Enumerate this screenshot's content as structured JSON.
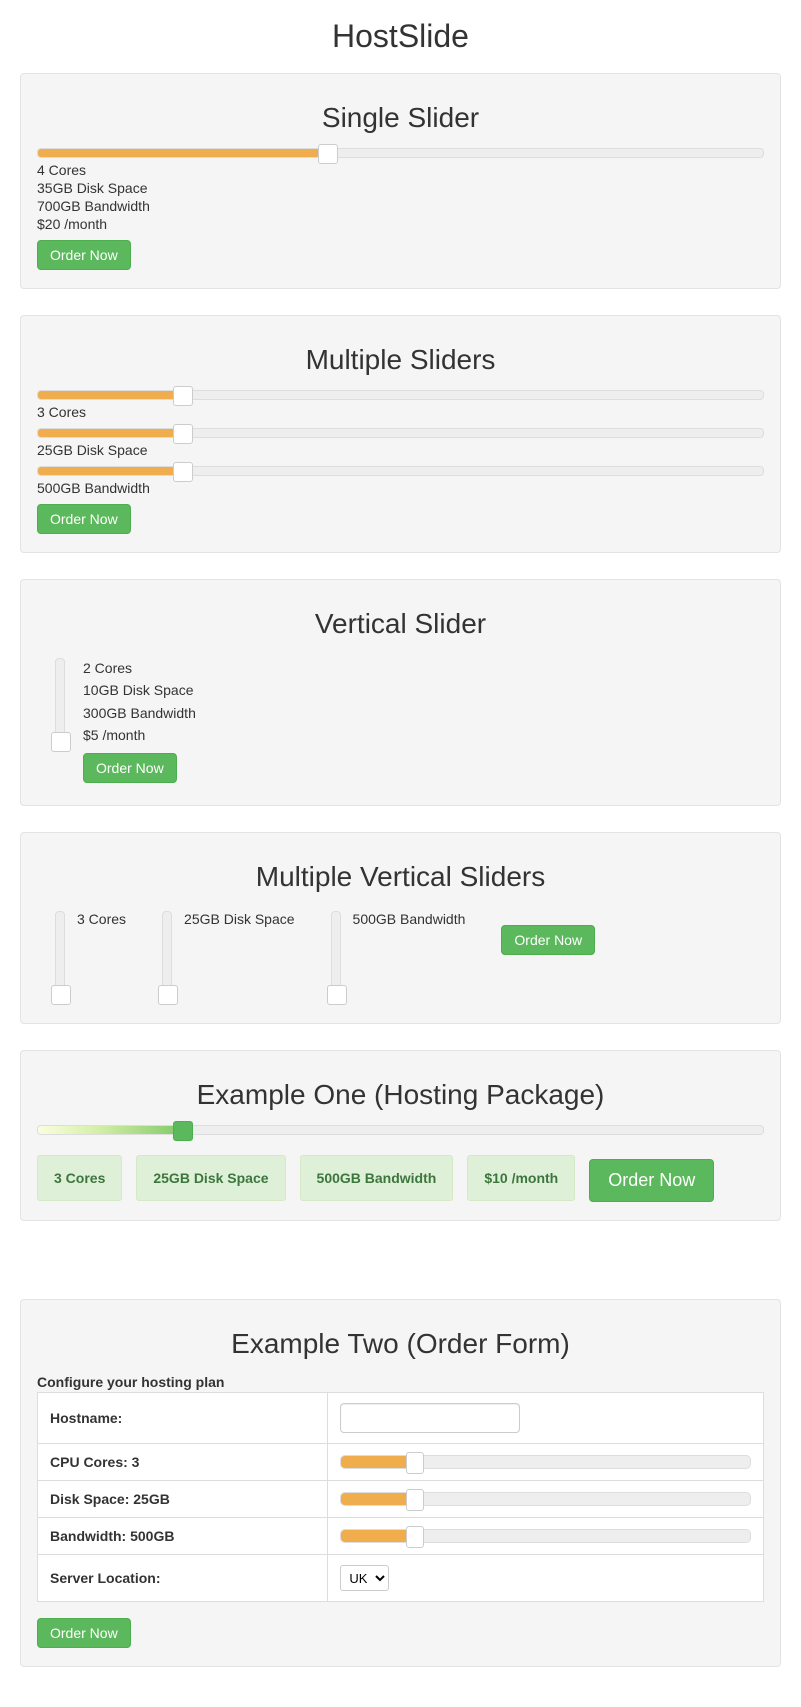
{
  "page_title": "HostSlide",
  "sections": {
    "single": {
      "title": "Single Slider",
      "slider_percent": 40,
      "cores": "4 Cores",
      "disk": "35GB Disk Space",
      "bandwidth": "700GB Bandwidth",
      "price": "$20 /month",
      "order": "Order Now"
    },
    "multiple": {
      "title": "Multiple Sliders",
      "sliders": {
        "cores_percent": 20,
        "disk_percent": 20,
        "band_percent": 20
      },
      "cores": "3 Cores",
      "disk": "25GB Disk Space",
      "bandwidth": "500GB Bandwidth",
      "order": "Order Now"
    },
    "vertical": {
      "title": "Vertical Slider",
      "slider_percent": 6,
      "cores": "2 Cores",
      "disk": "10GB Disk Space",
      "bandwidth": "300GB Bandwidth",
      "price": "$5 /month",
      "order": "Order Now"
    },
    "mvert": {
      "title": "Multiple Vertical Sliders",
      "cores_percent": 6,
      "disk_percent": 6,
      "band_percent": 6,
      "cores": "3 Cores",
      "disk": "25GB Disk Space",
      "bandwidth": "500GB Bandwidth",
      "order": "Order Now"
    },
    "ex1": {
      "title": "Example One (Hosting Package)",
      "slider_percent": 20,
      "cores": "3 Cores",
      "disk": "25GB Disk Space",
      "bandwidth": "500GB Bandwidth",
      "price": "$10 /month",
      "order": "Order Now"
    },
    "ex2": {
      "title": "Example Two (Order Form)",
      "caption": "Configure your hosting plan",
      "rows": {
        "hostname_label": "Hostname:",
        "hostname_value": "",
        "cpu_label": "CPU Cores: 3",
        "cpu_percent": 18,
        "disk_label": "Disk Space: 25GB",
        "disk_percent": 18,
        "band_label": "Bandwidth: 500GB",
        "band_percent": 18,
        "loc_label": "Server Location:",
        "loc_value": "UK"
      },
      "order": "Order Now"
    }
  }
}
